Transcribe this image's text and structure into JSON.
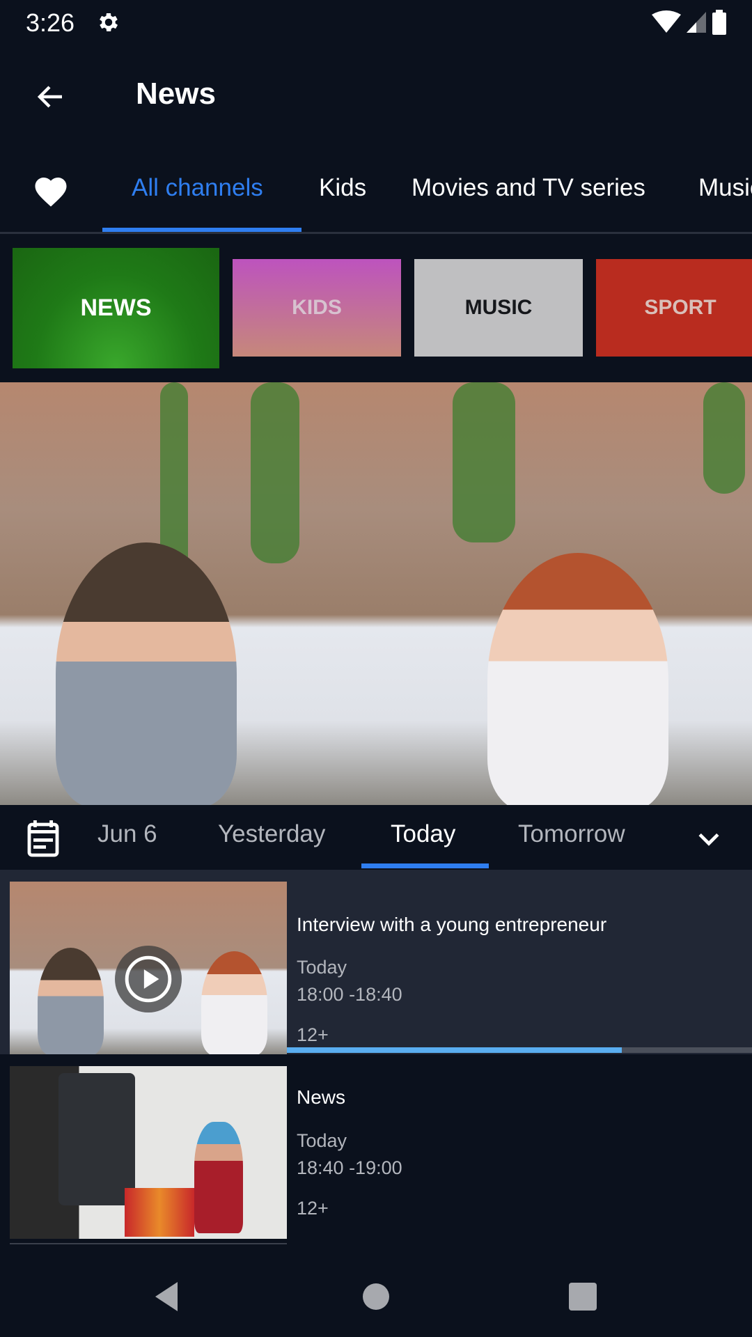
{
  "status_bar": {
    "time": "3:26",
    "icons": [
      "gear-icon",
      "wifi-icon",
      "signal-icon",
      "battery-icon"
    ]
  },
  "toolbar": {
    "title": "News",
    "back_icon": "arrow-left-icon"
  },
  "channel_tabs": {
    "favorite_icon": "heart-icon",
    "items": [
      {
        "label": "All channels",
        "active": true
      },
      {
        "label": "Kids",
        "active": false
      },
      {
        "label": "Movies and TV series",
        "active": false
      },
      {
        "label": "Music",
        "active": false
      }
    ]
  },
  "category_tiles": [
    {
      "label": "NEWS",
      "color": "#2a8f1f",
      "selected": true
    },
    {
      "label": "KIDS",
      "color": "#bd53be",
      "selected": false
    },
    {
      "label": "MUSIC",
      "color": "#bfbfc1",
      "selected": false
    },
    {
      "label": "SPORT",
      "color": "#b92c1f",
      "selected": false
    }
  ],
  "date_tabs": {
    "calendar_icon": "calendar-icon",
    "items": [
      {
        "label": "Jun 6",
        "active": false
      },
      {
        "label": "Yesterday",
        "active": false
      },
      {
        "label": "Today",
        "active": true
      },
      {
        "label": "Tomorrow",
        "active": false
      }
    ],
    "expand_icon": "chevron-down-icon"
  },
  "programs": [
    {
      "title": "Interview with a young entrepreneur",
      "day": "Today",
      "time": "18:00 -18:40",
      "age_rating": "12+",
      "is_live": true,
      "progress": 0.72
    },
    {
      "title": "News",
      "day": "Today",
      "time": "18:40 -19:00",
      "age_rating": "12+",
      "is_live": false
    }
  ],
  "colors": {
    "accent": "#2f7ef0",
    "background": "#0b111d",
    "current_row": "#212735",
    "progress": "#5aaef0"
  },
  "nav_bar": {
    "buttons": [
      "back-triangle-icon",
      "home-circle-icon",
      "recents-square-icon"
    ]
  }
}
